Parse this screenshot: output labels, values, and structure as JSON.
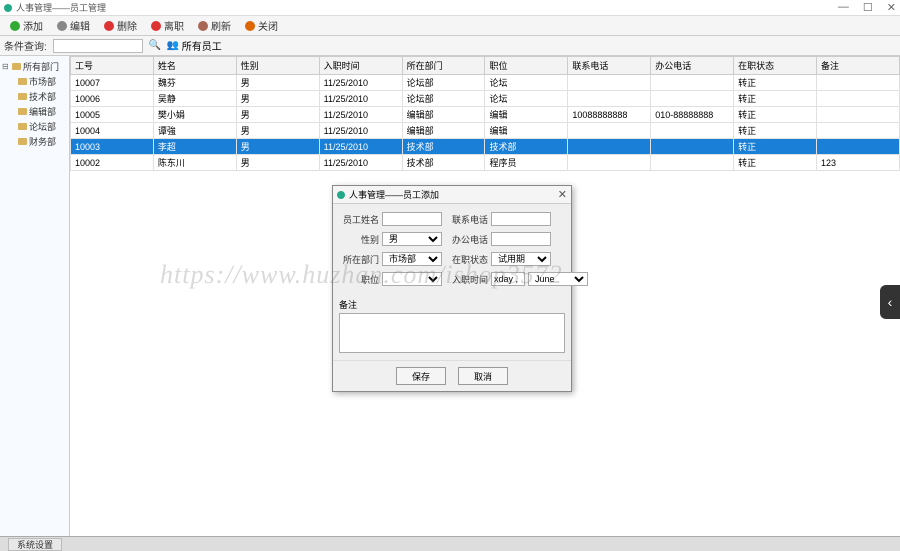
{
  "titlebar": {
    "title": "人事管理——员工管理"
  },
  "toolbar": {
    "add": "添加",
    "edit": "编辑",
    "delete": "删除",
    "leave": "离职",
    "refresh": "刷新",
    "close": "关闭"
  },
  "searchbar": {
    "label": "条件查询:",
    "all_emp": "所有员工"
  },
  "tree": {
    "root": "所有部门",
    "items": [
      "市场部",
      "技术部",
      "编辑部",
      "论坛部",
      "财务部"
    ]
  },
  "grid": {
    "headers": [
      "工号",
      "姓名",
      "性别",
      "入职时间",
      "所在部门",
      "职位",
      "联系电话",
      "办公电话",
      "在职状态",
      "备注"
    ],
    "rows": [
      {
        "c": [
          "10007",
          "魏芬",
          "男",
          "11/25/2010",
          "论坛部",
          "论坛",
          "",
          "",
          "转正",
          ""
        ]
      },
      {
        "c": [
          "10006",
          "吴静",
          "男",
          "11/25/2010",
          "论坛部",
          "论坛",
          "",
          "",
          "转正",
          ""
        ]
      },
      {
        "c": [
          "10005",
          "樊小娟",
          "男",
          "11/25/2010",
          "编辑部",
          "编辑",
          "10088888888",
          "010-88888888",
          "转正",
          ""
        ]
      },
      {
        "c": [
          "10004",
          "谭強",
          "男",
          "11/25/2010",
          "编辑部",
          "编辑",
          "",
          "",
          "转正",
          ""
        ]
      },
      {
        "c": [
          "10003",
          "李超",
          "男",
          "11/25/2010",
          "技术部",
          "技术部",
          "",
          "",
          "转正",
          ""
        ],
        "sel": true
      },
      {
        "c": [
          "10002",
          "陈东川",
          "男",
          "11/25/2010",
          "技术部",
          "程序员",
          "",
          "",
          "转正",
          "123"
        ]
      }
    ]
  },
  "dialog": {
    "title": "人事管理——员工添加",
    "labels": {
      "name": "员工姓名",
      "gender": "性别",
      "dept": "所在部门",
      "position": "职位",
      "phone": "联系电话",
      "office": "办公电话",
      "status": "在职状态",
      "hire": "入职时间",
      "remark": "备注"
    },
    "values": {
      "gender": "男",
      "dept": "市场部",
      "status": "试用期",
      "hire_d": "xday ,",
      "hire_m": "June"
    },
    "btn_save": "保存",
    "btn_cancel": "取消"
  },
  "statusbar": {
    "tab": "系统设置"
  },
  "watermark": "https://www.huzhan.com/ishop3572"
}
